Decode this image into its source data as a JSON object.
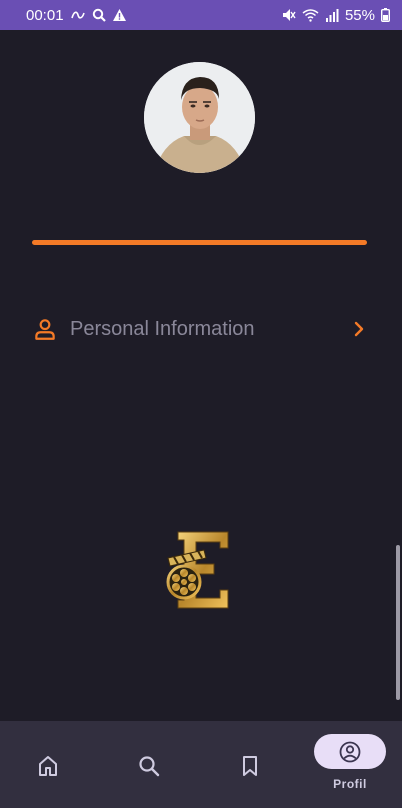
{
  "status_bar": {
    "time": "00:01",
    "battery": "55%",
    "icons": [
      "link-icon",
      "search-icon",
      "warning-icon",
      "mute-icon",
      "wifi-icon",
      "signal-icon",
      "battery-icon"
    ]
  },
  "profile": {
    "avatar_alt": "profile-photo"
  },
  "menu": {
    "items": [
      {
        "label": "Personal Information",
        "icon": "person-icon"
      }
    ]
  },
  "bottom_nav": {
    "items": [
      {
        "icon": "home-icon",
        "label": ""
      },
      {
        "icon": "search-icon",
        "label": ""
      },
      {
        "icon": "bookmark-icon",
        "label": ""
      },
      {
        "icon": "profile-icon",
        "label": "Profil",
        "active": true
      }
    ]
  },
  "colors": {
    "background": "#1e1c27",
    "status_bar": "#6a4fb4",
    "accent": "#f47a27",
    "nav_background": "#322f3f",
    "active_pill": "#e8def7"
  }
}
